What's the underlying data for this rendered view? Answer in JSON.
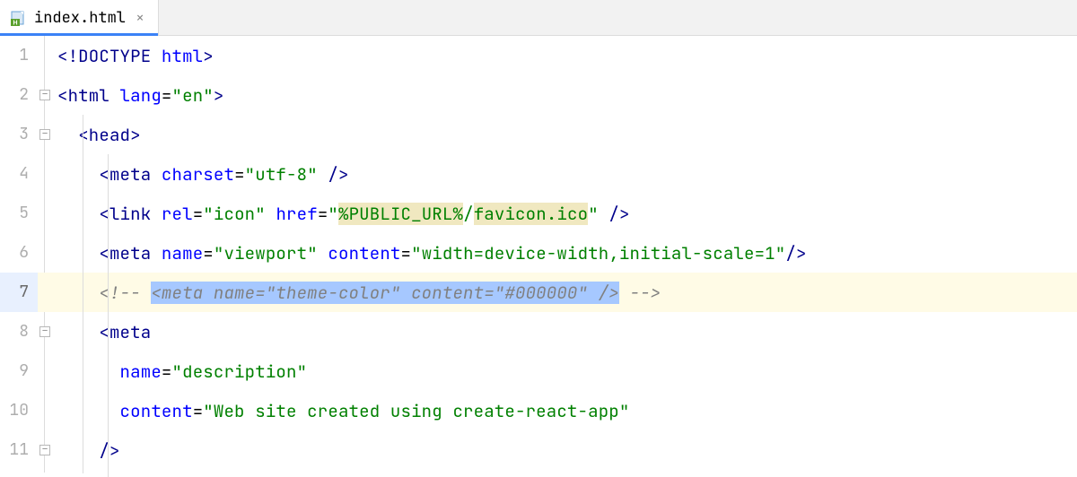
{
  "tab": {
    "filename": "index.html",
    "close_tooltip": "Close"
  },
  "gutter": {
    "lines": [
      "1",
      "2",
      "3",
      "4",
      "5",
      "6",
      "7",
      "8",
      "9",
      "10",
      "11"
    ]
  },
  "code": {
    "l1": {
      "doctype": "<!DOCTYPE ",
      "html": "html",
      "close": ">"
    },
    "l2": {
      "open": "<html ",
      "attr": "lang",
      "eq": "=",
      "val": "\"en\"",
      "close": ">"
    },
    "l3": {
      "open": "<head",
      "close": ">"
    },
    "l4": {
      "open": "<meta ",
      "attr": "charset",
      "eq": "=",
      "val": "\"utf-8\"",
      "close": " />"
    },
    "l5": {
      "open": "<link ",
      "attr1": "rel",
      "eq1": "=",
      "val1": "\"icon\"",
      "attr2": "href",
      "eq2": "=",
      "q1": "\"",
      "path1": "%PUBLIC_URL%",
      "slash": "/",
      "path2": "favicon.ico",
      "q2": "\"",
      "close": " />"
    },
    "l6": {
      "open": "<meta ",
      "attr1": "name",
      "val1": "\"viewport\"",
      "attr2": "content",
      "val2": "\"width=device-width,initial-scale=1\"",
      "close": "/>"
    },
    "l7": {
      "cstart": "<!-- ",
      "sel": "<meta name=\"theme-color\" content=\"#000000\" />",
      "cend": " -->"
    },
    "l8": {
      "open": "<meta"
    },
    "l9": {
      "attr": "name",
      "eq": "=",
      "val": "\"description\""
    },
    "l10": {
      "attr": "content",
      "eq": "=",
      "val": "\"Web site created using create-react-app\""
    },
    "l11": {
      "close": "/>"
    }
  }
}
